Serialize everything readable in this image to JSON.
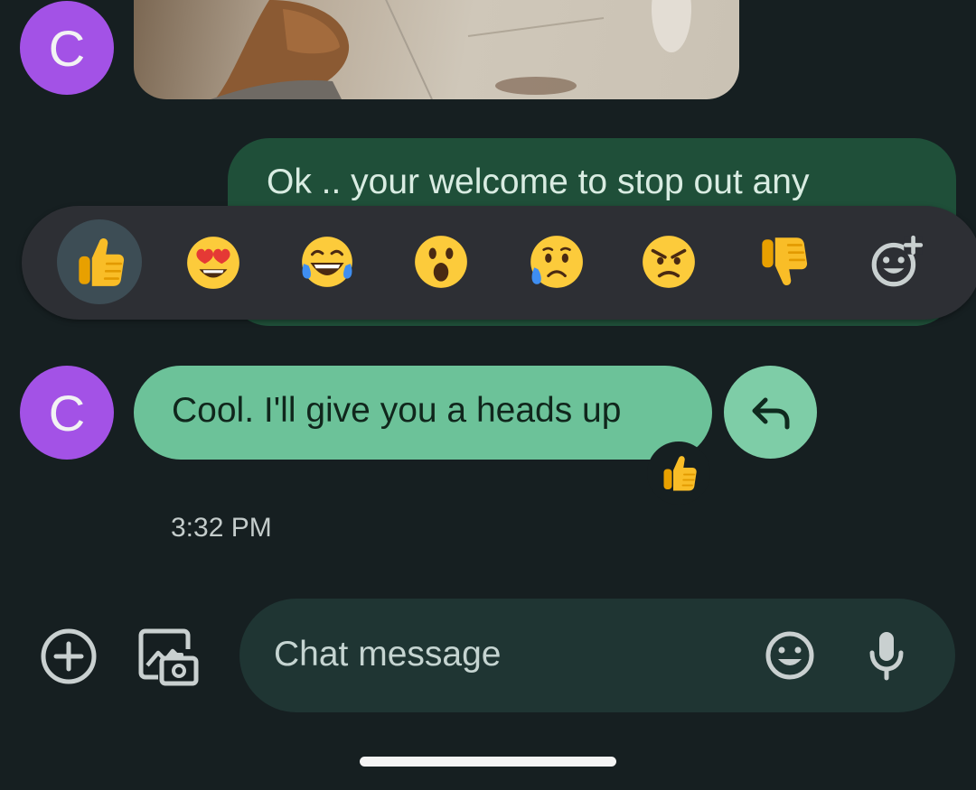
{
  "conversation": {
    "photo_message": {
      "sender_initial": "C"
    },
    "sent_message": {
      "text": "Ok .. your welcome to stop out any"
    },
    "reaction_picker": {
      "emojis": [
        {
          "name": "thumbs-up",
          "selected": true
        },
        {
          "name": "heart-eyes",
          "selected": false
        },
        {
          "name": "tears-of-joy",
          "selected": false
        },
        {
          "name": "surprised",
          "selected": false
        },
        {
          "name": "sad-sweat",
          "selected": false
        },
        {
          "name": "angry",
          "selected": false
        },
        {
          "name": "thumbs-down",
          "selected": false
        },
        {
          "name": "add-reaction",
          "selected": false
        }
      ]
    },
    "received_message": {
      "sender_initial": "C",
      "text": "Cool. I'll give you a heads up",
      "reaction": "thumbs-up",
      "timestamp": "3:32 PM"
    }
  },
  "compose": {
    "placeholder": "Chat message"
  },
  "colors": {
    "background": "#161f21",
    "avatar": "#a352e6",
    "sent_bubble": "#1f4f39",
    "received_bubble": "#6cc299",
    "reply_button": "#7ecda7",
    "reaction_bar": "#2d2f34",
    "compose_field": "#1f3533"
  }
}
